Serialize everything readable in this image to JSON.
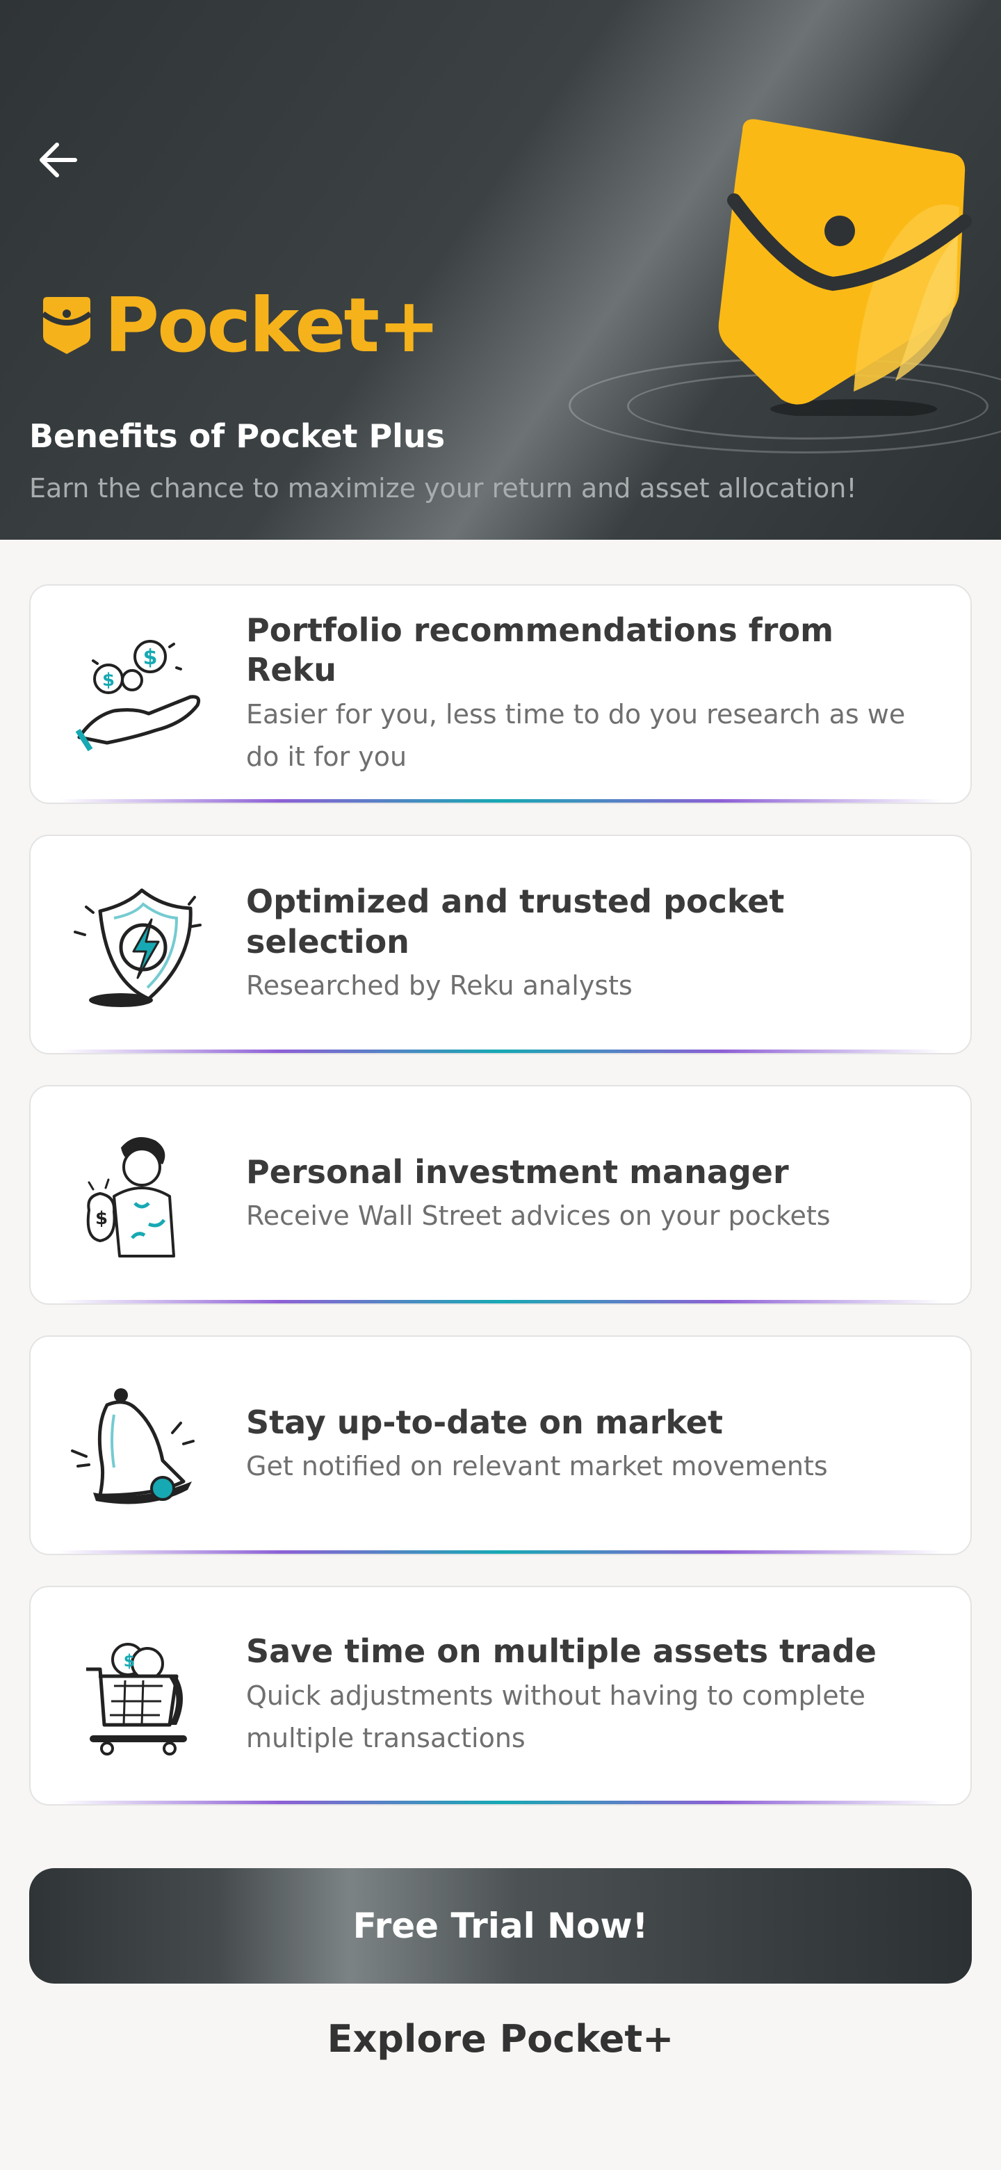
{
  "header": {
    "brand_name": "Pocket+",
    "title": "Benefits of Pocket Plus",
    "subtitle": "Earn the chance to maximize your return and asset allocation!"
  },
  "benefits": [
    {
      "icon": "coin-hand-icon",
      "title": "Portfolio recommendations from Reku",
      "desc": "Easier for you, less time to do you research as we do it for you"
    },
    {
      "icon": "shield-lightning-icon",
      "title": "Optimized and trusted pocket selection",
      "desc": "Researched by Reku analysts"
    },
    {
      "icon": "investment-manager-icon",
      "title": "Personal investment manager",
      "desc": "Receive Wall Street advices on your pockets"
    },
    {
      "icon": "bell-icon",
      "title": "Stay up-to-date on market",
      "desc": "Get notified on relevant market movements"
    },
    {
      "icon": "shopping-cart-coins-icon",
      "title": "Save time on multiple assets trade",
      "desc": "Quick adjustments without having to complete multiple transactions"
    }
  ],
  "cta": {
    "label": "Free Trial Now!"
  },
  "explore": {
    "label": "Explore Pocket+"
  },
  "colors": {
    "brand_yellow": "#f5b21b",
    "accent_teal": "#17a9b3",
    "accent_purple": "#8e60d6",
    "header_dark": "#2f3436"
  }
}
